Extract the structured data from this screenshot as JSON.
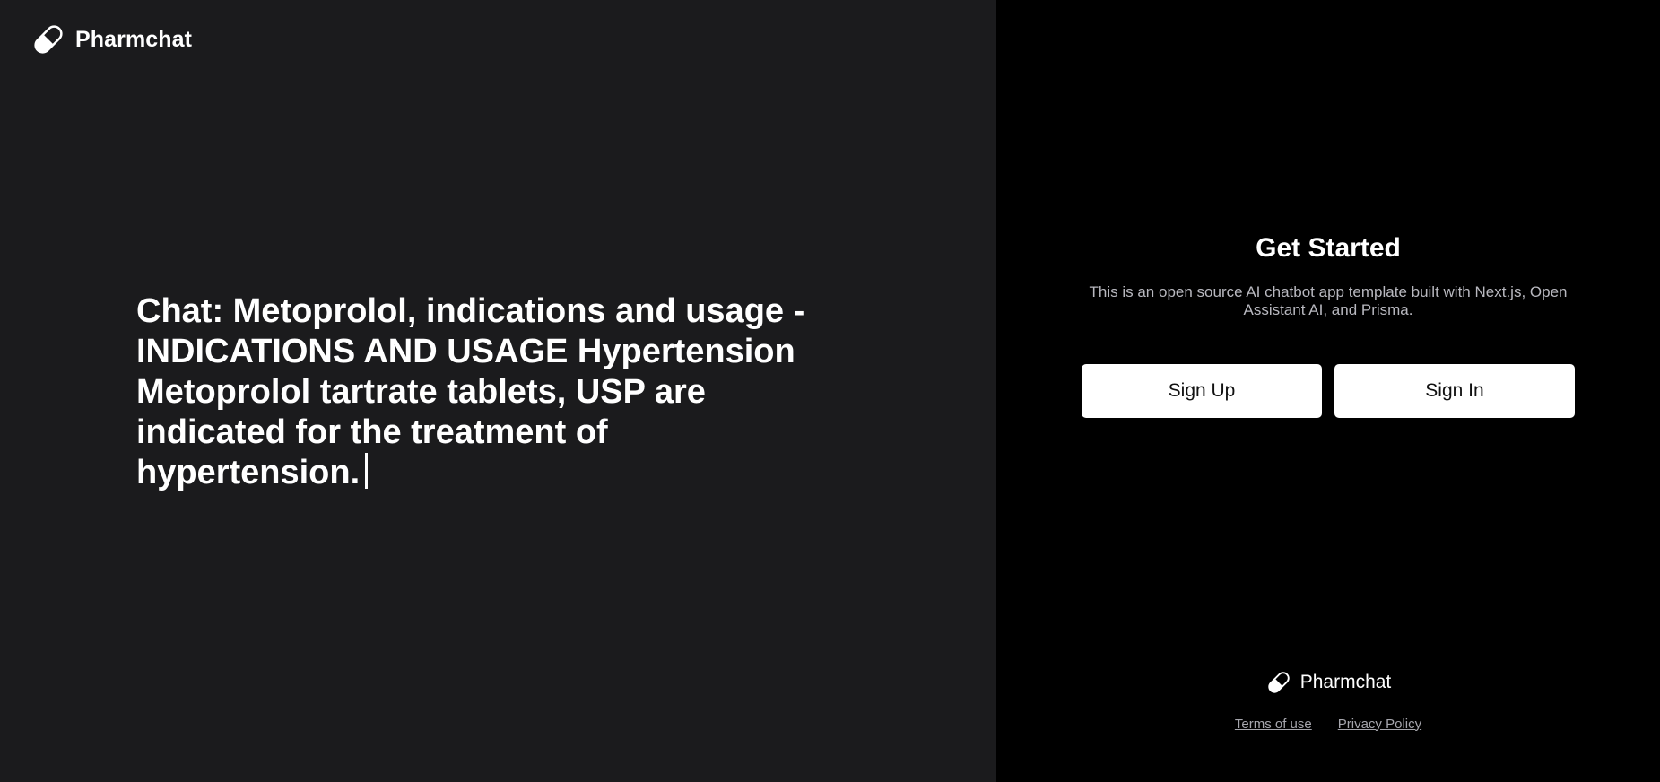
{
  "brand": {
    "name": "Pharmchat",
    "icon": "pill-icon"
  },
  "hero": {
    "text": "Chat: Metoprolol, indications and usage - INDICATIONS AND USAGE Hypertension Metoprolol tartrate tablets, USP are indicated for the treatment of hypertension."
  },
  "auth": {
    "title": "Get Started",
    "description": "This is an open source AI chatbot app template built with Next.js, Open Assistant AI, and Prisma.",
    "sign_up_label": "Sign Up",
    "sign_in_label": "Sign In"
  },
  "footer": {
    "brand_name": "Pharmchat",
    "terms_label": "Terms of use",
    "privacy_label": "Privacy Policy"
  },
  "colors": {
    "left_background": "#1b1b1d",
    "right_background": "#000000",
    "button_background": "#ffffff",
    "muted_text": "#b8b8bf"
  }
}
